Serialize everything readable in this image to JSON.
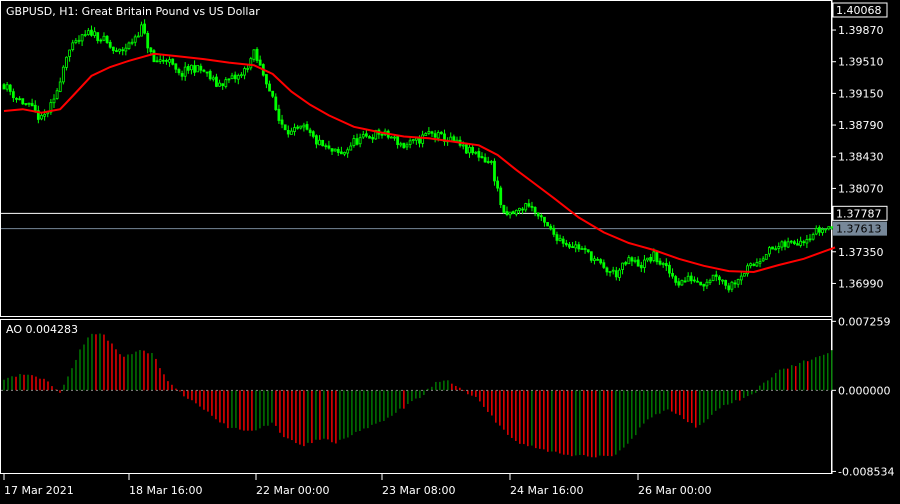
{
  "header": {
    "symbol_info": "GBPUSD, H1:  Great Britain Pound vs US Dollar"
  },
  "colors": {
    "background": "#000000",
    "frame": "#ffffff",
    "candle": "#00ff00",
    "ma_line": "#ff0000",
    "ao_up": "#008000",
    "ao_down": "#ff0000",
    "current_price_tag": "#778899"
  },
  "chart_data": [
    {
      "type": "candlestick",
      "title": "GBPUSD, H1:  Great Britain Pound vs US Dollar",
      "ylim": [
        1.3662,
        1.402
      ],
      "y_ticks": [
        "1.39870",
        "1.39510",
        "1.39150",
        "1.38790",
        "1.38430",
        "1.38070",
        "1.37350",
        "1.36990"
      ],
      "top_tag": "1.40068",
      "horizontal_line_tag": "1.37787",
      "current_price_tag": "1.37613",
      "x_ticks": [
        "17 Mar 2021",
        "18 Mar 16:00",
        "22 Mar 00:00",
        "23 Mar 08:00",
        "24 Mar 16:00",
        "26 Mar 00:00"
      ],
      "close_path": [
        [
          0,
          1.3925
        ],
        [
          10,
          1.391
        ],
        [
          20,
          1.39
        ],
        [
          30,
          1.3885
        ],
        [
          40,
          1.3905
        ],
        [
          50,
          1.396
        ],
        [
          60,
          1.3975
        ],
        [
          70,
          1.3985
        ],
        [
          80,
          1.3975
        ],
        [
          90,
          1.396
        ],
        [
          100,
          1.397
        ],
        [
          110,
          1.399
        ],
        [
          120,
          1.395
        ],
        [
          130,
          1.3955
        ],
        [
          140,
          1.3935
        ],
        [
          150,
          1.3945
        ],
        [
          160,
          1.394
        ],
        [
          170,
          1.3925
        ],
        [
          180,
          1.393
        ],
        [
          190,
          1.3935
        ],
        [
          200,
          1.396
        ],
        [
          210,
          1.393
        ],
        [
          220,
          1.3885
        ],
        [
          230,
          1.387
        ],
        [
          240,
          1.3875
        ],
        [
          250,
          1.386
        ],
        [
          260,
          1.385
        ],
        [
          270,
          1.3845
        ],
        [
          280,
          1.386
        ],
        [
          290,
          1.3865
        ],
        [
          300,
          1.387
        ],
        [
          310,
          1.3865
        ],
        [
          320,
          1.3855
        ],
        [
          330,
          1.386
        ],
        [
          340,
          1.387
        ],
        [
          350,
          1.3865
        ],
        [
          360,
          1.386
        ],
        [
          370,
          1.385
        ],
        [
          380,
          1.3845
        ],
        [
          390,
          1.3835
        ],
        [
          400,
          1.3775
        ],
        [
          410,
          1.378
        ],
        [
          420,
          1.379
        ],
        [
          430,
          1.377
        ],
        [
          440,
          1.3755
        ],
        [
          450,
          1.3745
        ],
        [
          460,
          1.374
        ],
        [
          470,
          1.373
        ],
        [
          480,
          1.3715
        ],
        [
          490,
          1.371
        ],
        [
          500,
          1.3725
        ],
        [
          510,
          1.372
        ],
        [
          520,
          1.373
        ],
        [
          530,
          1.3715
        ],
        [
          540,
          1.37
        ],
        [
          550,
          1.3705
        ],
        [
          560,
          1.37
        ],
        [
          570,
          1.371
        ],
        [
          580,
          1.3695
        ],
        [
          590,
          1.371
        ],
        [
          600,
          1.372
        ],
        [
          610,
          1.3735
        ],
        [
          620,
          1.374
        ],
        [
          630,
          1.3745
        ],
        [
          640,
          1.375
        ],
        [
          650,
          1.3758
        ],
        [
          660,
          1.3763
        ]
      ],
      "moving_average": [
        [
          0,
          1.3895
        ],
        [
          15,
          1.3897
        ],
        [
          30,
          1.3893
        ],
        [
          45,
          1.3897
        ],
        [
          55,
          1.3912
        ],
        [
          70,
          1.3935
        ],
        [
          85,
          1.3945
        ],
        [
          100,
          1.3952
        ],
        [
          120,
          1.396
        ],
        [
          140,
          1.3957
        ],
        [
          160,
          1.3954
        ],
        [
          180,
          1.395
        ],
        [
          200,
          1.3947
        ],
        [
          215,
          1.3937
        ],
        [
          230,
          1.3917
        ],
        [
          245,
          1.3902
        ],
        [
          260,
          1.389
        ],
        [
          280,
          1.3877
        ],
        [
          300,
          1.3871
        ],
        [
          320,
          1.3866
        ],
        [
          340,
          1.3864
        ],
        [
          360,
          1.386
        ],
        [
          380,
          1.3856
        ],
        [
          395,
          1.3845
        ],
        [
          410,
          1.3828
        ],
        [
          425,
          1.3812
        ],
        [
          440,
          1.3796
        ],
        [
          460,
          1.3774
        ],
        [
          480,
          1.3757
        ],
        [
          500,
          1.3745
        ],
        [
          520,
          1.3737
        ],
        [
          540,
          1.3727
        ],
        [
          560,
          1.3719
        ],
        [
          580,
          1.3713
        ],
        [
          600,
          1.3712
        ],
        [
          620,
          1.372
        ],
        [
          640,
          1.3727
        ],
        [
          665,
          1.374
        ]
      ]
    },
    {
      "type": "bar",
      "title": "AO 0.004283",
      "label": "AO 0.004283",
      "ylim": [
        -0.0087,
        0.0074
      ],
      "y_ticks": [
        "0.007259",
        "0.000000",
        "-0.008534"
      ],
      "ao_path": [
        [
          0,
          0.0012
        ],
        [
          20,
          0.0018
        ],
        [
          35,
          0.001
        ],
        [
          45,
          -0.0002
        ],
        [
          60,
          0.004
        ],
        [
          70,
          0.006
        ],
        [
          80,
          0.0058
        ],
        [
          95,
          0.0035
        ],
        [
          110,
          0.0042
        ],
        [
          120,
          0.0038
        ],
        [
          130,
          0.001
        ],
        [
          140,
          -0.0002
        ],
        [
          160,
          -0.002
        ],
        [
          180,
          -0.004
        ],
        [
          200,
          -0.0042
        ],
        [
          215,
          -0.0035
        ],
        [
          225,
          -0.005
        ],
        [
          240,
          -0.0058
        ],
        [
          255,
          -0.005
        ],
        [
          265,
          -0.0055
        ],
        [
          280,
          -0.0045
        ],
        [
          300,
          -0.0035
        ],
        [
          320,
          -0.0018
        ],
        [
          335,
          -0.0005
        ],
        [
          345,
          0.0008
        ],
        [
          355,
          0.001
        ],
        [
          365,
          0.0002
        ],
        [
          380,
          -0.001
        ],
        [
          395,
          -0.0035
        ],
        [
          410,
          -0.0055
        ],
        [
          430,
          -0.0062
        ],
        [
          450,
          -0.0068
        ],
        [
          470,
          -0.007
        ],
        [
          490,
          -0.0068
        ],
        [
          500,
          -0.0055
        ],
        [
          515,
          -0.003
        ],
        [
          530,
          -0.002
        ],
        [
          545,
          -0.003
        ],
        [
          555,
          -0.004
        ],
        [
          570,
          -0.002
        ],
        [
          585,
          -0.0012
        ],
        [
          600,
          -0.0005
        ],
        [
          605,
          0.0006
        ],
        [
          620,
          0.002
        ],
        [
          640,
          0.003
        ],
        [
          655,
          0.0038
        ],
        [
          665,
          0.0043
        ]
      ]
    }
  ]
}
